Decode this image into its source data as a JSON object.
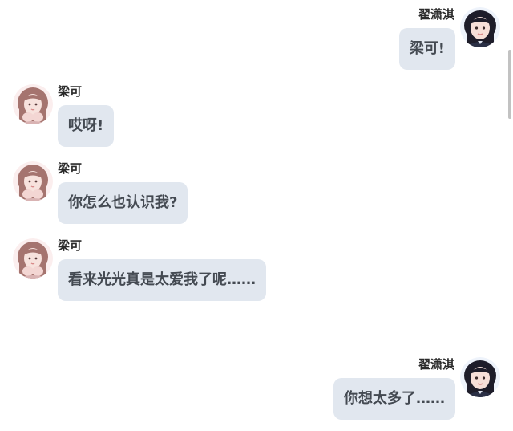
{
  "users": {
    "self": {
      "name": "翟潇淇",
      "avatar_icon": "girl-dark-hair-avatar-icon"
    },
    "other": {
      "name": "梁可",
      "avatar_icon": "girl-brown-hair-avatar-icon"
    }
  },
  "messages": [
    {
      "sender": "翟潇淇",
      "side": "right",
      "text": "梁可!"
    },
    {
      "sender": "梁可",
      "side": "left",
      "text": "哎呀!"
    },
    {
      "sender": "梁可",
      "side": "left",
      "text": "你怎么也认识我?"
    },
    {
      "sender": "梁可",
      "side": "left",
      "text": "看来光光真是太爱我了呢……"
    },
    {
      "sender": "翟潇淇",
      "side": "right",
      "text": "你想太多了……"
    }
  ],
  "colors": {
    "bubble": "#e1e7ef",
    "bubble_text": "#444a52",
    "name_text": "#2b2b2b",
    "scrollbar_thumb": "#c2c2c2"
  }
}
